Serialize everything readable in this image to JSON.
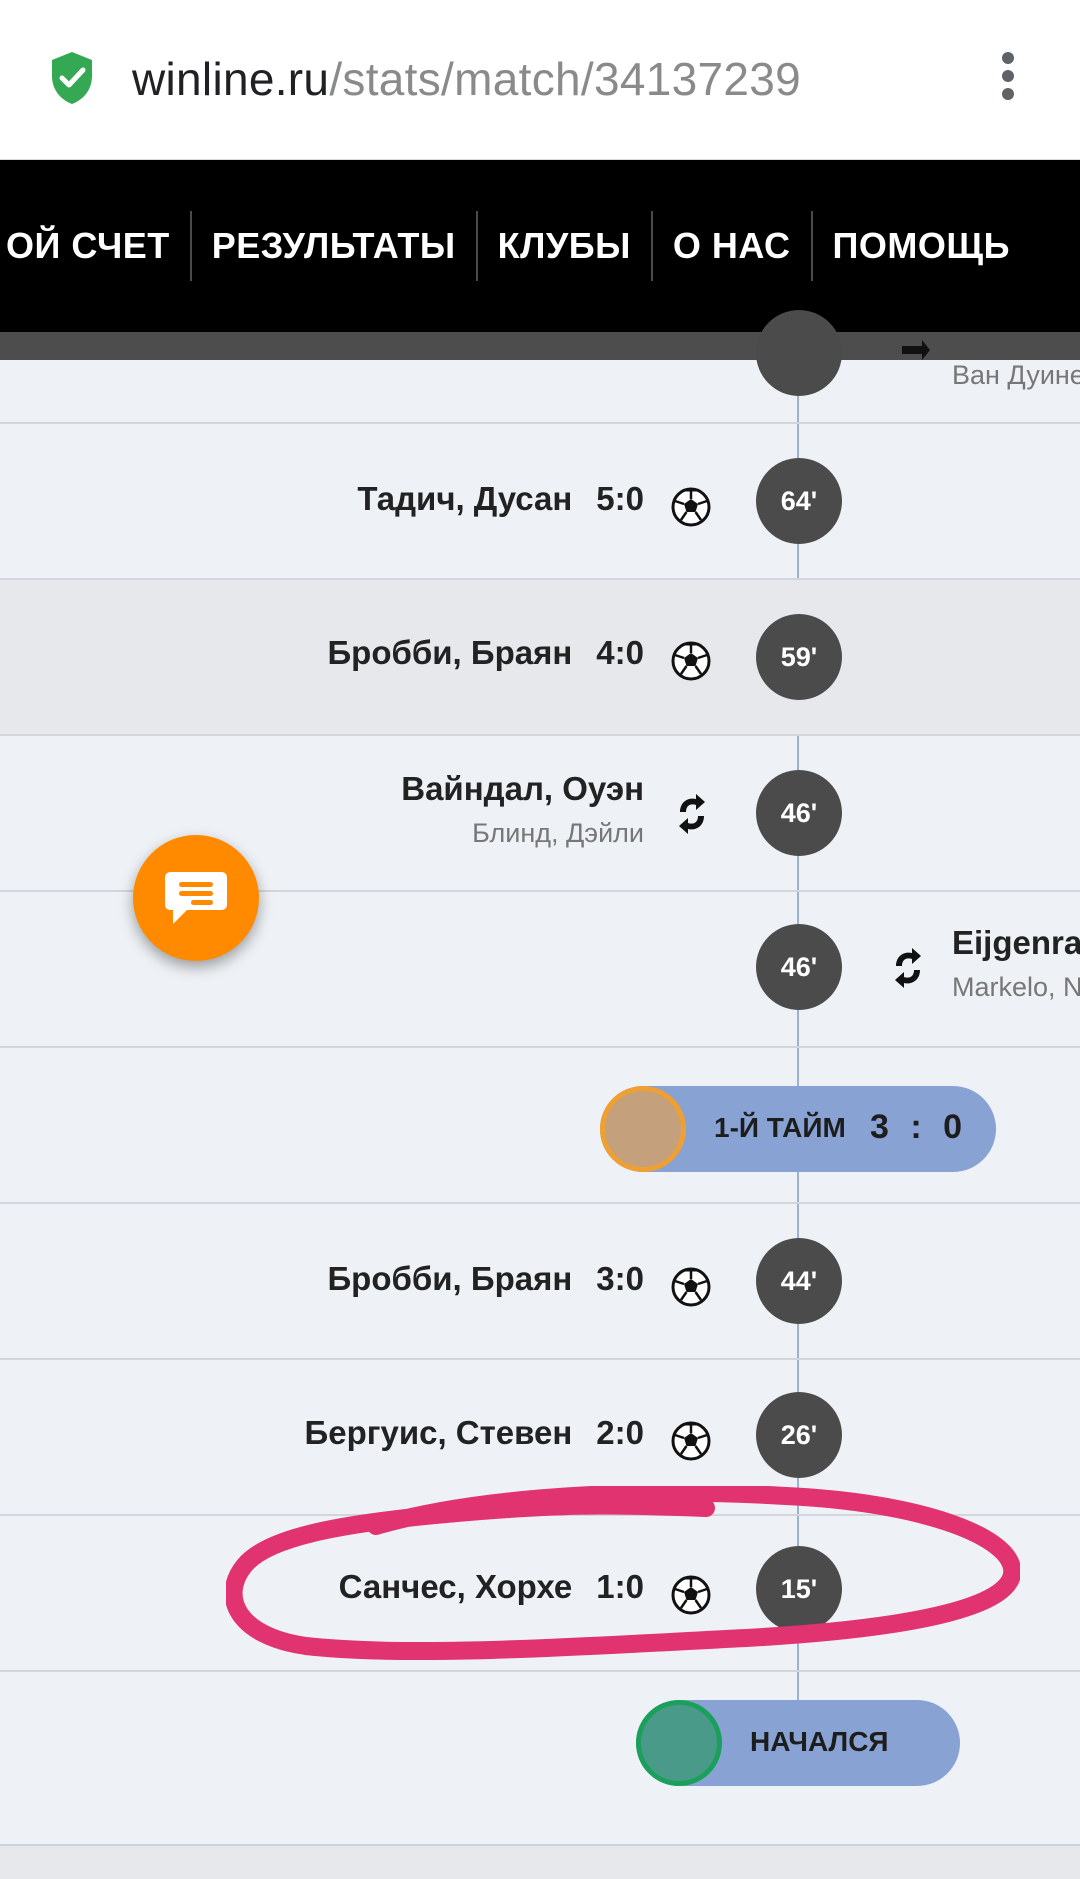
{
  "browser": {
    "url_host": "winline.ru",
    "url_path": "/stats/match/34137239",
    "secure_icon": "shield-check-icon",
    "menu_icon": "kebab-menu-icon"
  },
  "nav": {
    "items": [
      {
        "label": "ОЙ СЧЕТ"
      },
      {
        "label": "РЕЗУЛЬТАТЫ"
      },
      {
        "label": "КЛУБЫ"
      },
      {
        "label": "О НАС"
      },
      {
        "label": "ПОМОЩЬ"
      }
    ]
  },
  "timeline": {
    "events": [
      {
        "minute": "",
        "side": "right",
        "type": "substitution",
        "sub_name": "Ван Дуине"
      },
      {
        "minute": "64'",
        "side": "left",
        "type": "goal",
        "player": "Тадич, Дусан",
        "score": "5:0"
      },
      {
        "minute": "59'",
        "side": "left",
        "type": "goal",
        "player": "Бробби, Браян",
        "score": "4:0",
        "highlighted": true
      },
      {
        "minute": "46'",
        "side": "left",
        "type": "substitution",
        "player": "Вайндал, Оуэн",
        "sub_name": "Блинд, Дэйли"
      },
      {
        "minute": "46'",
        "side": "right",
        "type": "substitution",
        "player": "Eijgenraa",
        "sub_name": "Markelo, N"
      },
      {
        "minute": "44'",
        "side": "left",
        "type": "goal",
        "player": "Бробби, Браян",
        "score": "3:0"
      },
      {
        "minute": "26'",
        "side": "left",
        "type": "goal",
        "player": "Бергуис, Стевен",
        "score": "2:0"
      },
      {
        "minute": "15'",
        "side": "left",
        "type": "goal",
        "player": "Санчес, Хорхе",
        "score": "1:0",
        "annotated": true
      }
    ],
    "halftime": {
      "label": "1-Й ТАЙМ",
      "home": "3",
      "sep": ":",
      "away": "0"
    },
    "kickoff": {
      "label": "НАЧАЛСЯ"
    }
  },
  "colors": {
    "nav_bg": "#000000",
    "bubble": "#4b4b4b",
    "pill": "#88a2d3",
    "halftime_dot": "#c4a07c",
    "halftime_ring": "#f0a030",
    "kickoff_dot": "#4a9a8a",
    "kickoff_ring": "#1aa05a",
    "chat_button": "#ff8a00",
    "annotation": "#e0336f"
  },
  "chat_button_icon": "chat-icon"
}
